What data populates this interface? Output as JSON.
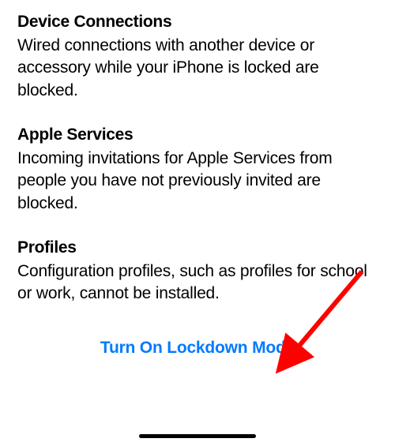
{
  "sections": [
    {
      "title": "Device Connections",
      "body": "Wired connections with another device or accessory while your iPhone is locked are blocked."
    },
    {
      "title": "Apple Services",
      "body": "Incoming invitations for Apple Services from people you have not previously invited are blocked."
    },
    {
      "title": "Profiles",
      "body": "Configuration profiles, such as profiles for school or work, cannot be installed."
    }
  ],
  "action": {
    "label": "Turn On Lockdown Mode"
  },
  "colors": {
    "link": "#007AFF",
    "annotation": "#FF0000"
  }
}
